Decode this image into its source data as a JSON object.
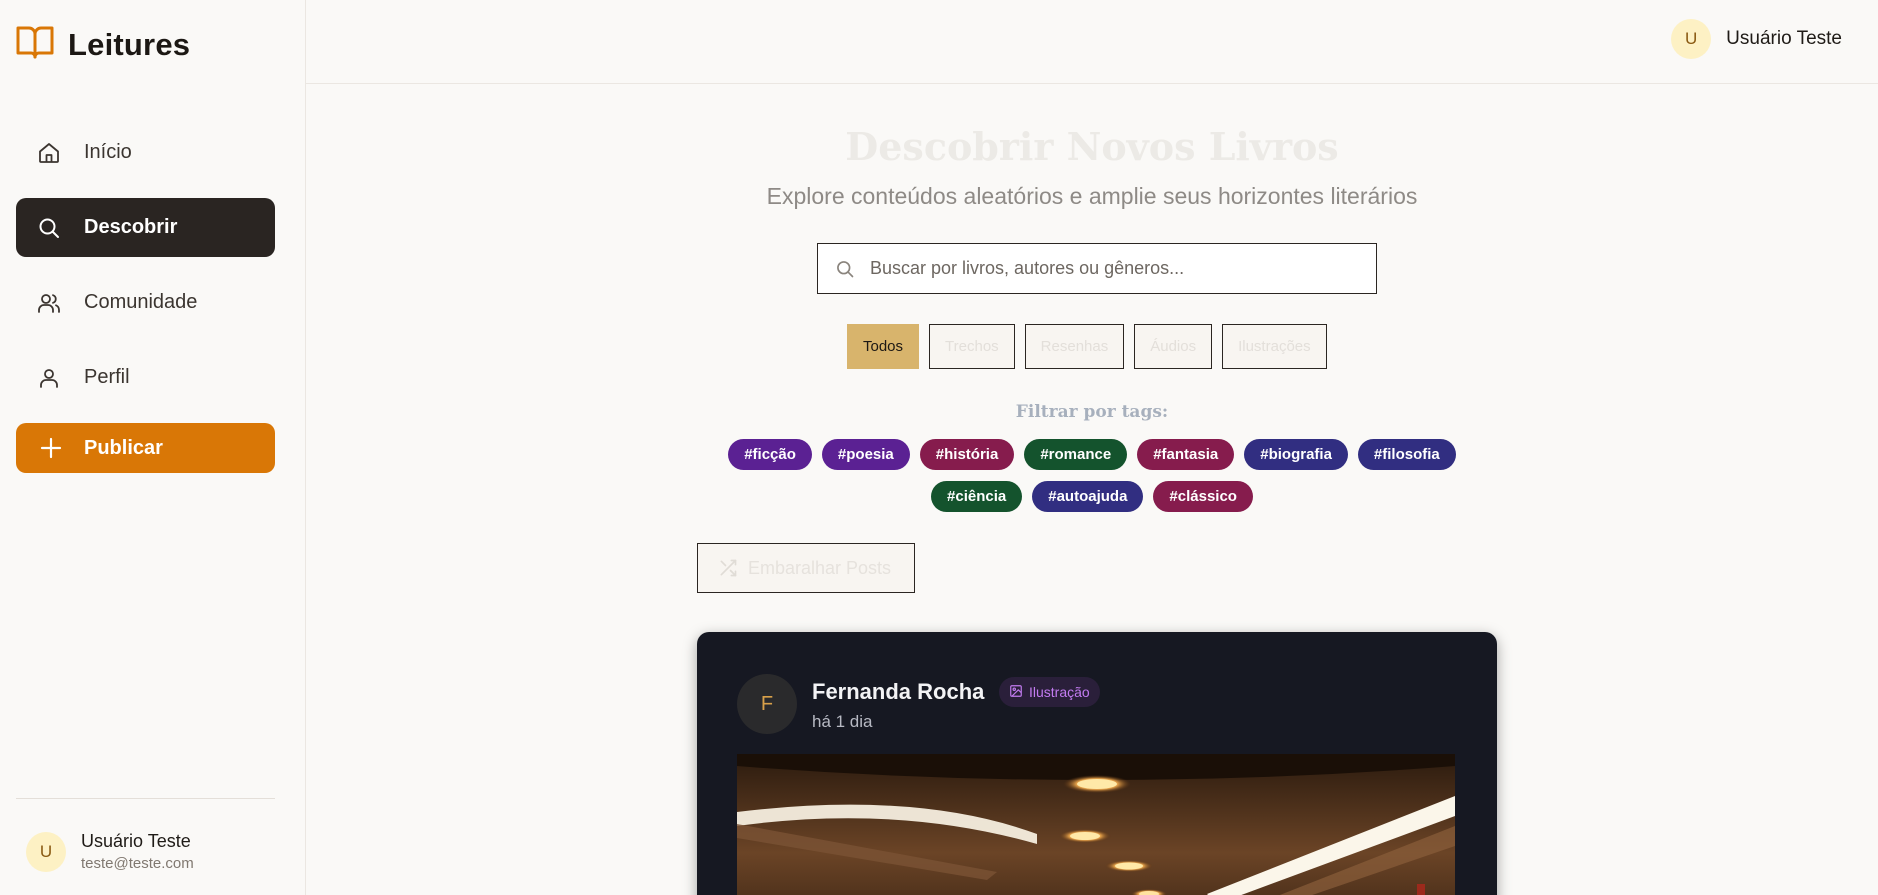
{
  "app": {
    "name": "Leitures"
  },
  "sidebar": {
    "items": [
      {
        "label": "Início",
        "icon": "home-icon",
        "active": false
      },
      {
        "label": "Descobrir",
        "icon": "search-icon",
        "active": true
      },
      {
        "label": "Comunidade",
        "icon": "users-icon",
        "active": false
      },
      {
        "label": "Perfil",
        "icon": "user-icon",
        "active": false
      }
    ],
    "publish_label": "Publicar",
    "user": {
      "initial": "U",
      "name": "Usuário Teste",
      "email": "teste@teste.com"
    }
  },
  "topbar": {
    "user": {
      "initial": "U",
      "name": "Usuário Teste"
    }
  },
  "main": {
    "title": "Descobrir Novos Livros",
    "subtitle": "Explore conteúdos aleatórios e amplie seus horizontes literários",
    "search": {
      "placeholder": "Buscar por livros, autores ou gêneros...",
      "value": ""
    },
    "filters": [
      {
        "label": "Todos",
        "active": true
      },
      {
        "label": "Trechos",
        "active": false
      },
      {
        "label": "Resenhas",
        "active": false
      },
      {
        "label": "Áudios",
        "active": false
      },
      {
        "label": "Ilustrações",
        "active": false
      }
    ],
    "tags_title": "Filtrar por tags:",
    "tags": [
      {
        "label": "#ficção",
        "color": "#5b2193"
      },
      {
        "label": "#poesia",
        "color": "#5b2193"
      },
      {
        "label": "#história",
        "color": "#861c4d"
      },
      {
        "label": "#romance",
        "color": "#14532d"
      },
      {
        "label": "#fantasia",
        "color": "#861c4d"
      },
      {
        "label": "#biografia",
        "color": "#312e81"
      },
      {
        "label": "#filosofia",
        "color": "#312e81"
      },
      {
        "label": "#ciência",
        "color": "#14532d"
      },
      {
        "label": "#autoajuda",
        "color": "#312e81"
      },
      {
        "label": "#clássico",
        "color": "#861c4d"
      }
    ],
    "shuffle_label": "Embaralhar Posts"
  },
  "post": {
    "author_initial": "F",
    "author": "Fernanda Rocha",
    "type_label": "Ilustração",
    "time": "há 1 dia"
  },
  "colors": {
    "accent": "#d97706",
    "active_nav": "#2a2522",
    "active_filter": "#d8b46c"
  }
}
